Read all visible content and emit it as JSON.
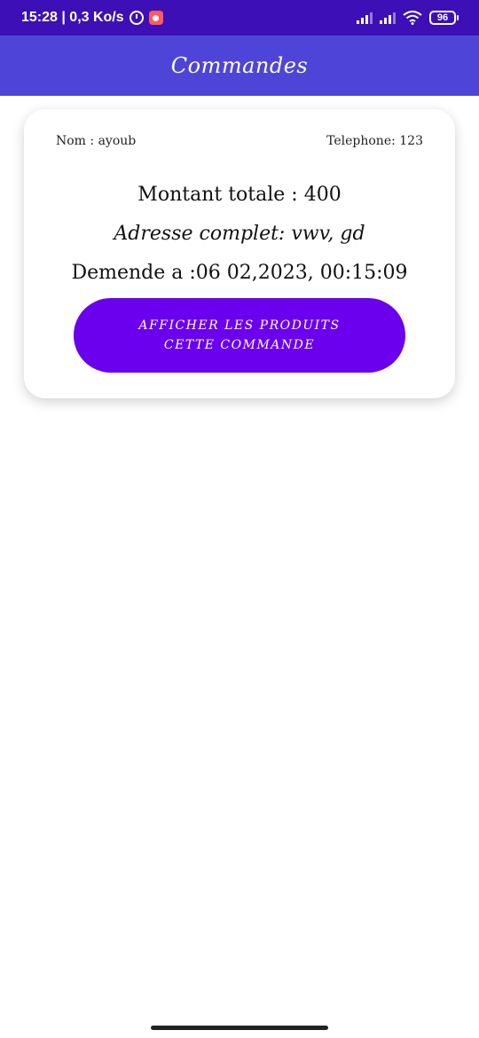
{
  "status_bar": {
    "time_speed": "15:28 | 0,3 Ko/s",
    "battery_level": "96",
    "icons": [
      "alarm-icon",
      "app-notification-icon",
      "signal-icon",
      "signal-icon",
      "wifi-icon",
      "battery-icon"
    ]
  },
  "app_bar": {
    "title": "Commandes"
  },
  "order": {
    "name": "Nom : ayoub",
    "telephone": "Telephone: 123",
    "amount": "Montant totale : 400",
    "address": "Adresse complet: vwv, gd",
    "date": "Demende a :06 02,2023, 00:15:09",
    "button_label": "AFFICHER LES PRODUITS CETTE COMMANDE"
  },
  "colors": {
    "status_bar": "#3d0fb6",
    "app_bar": "#4e45d8",
    "button": "#6a00ee",
    "card": "#ffffff"
  }
}
